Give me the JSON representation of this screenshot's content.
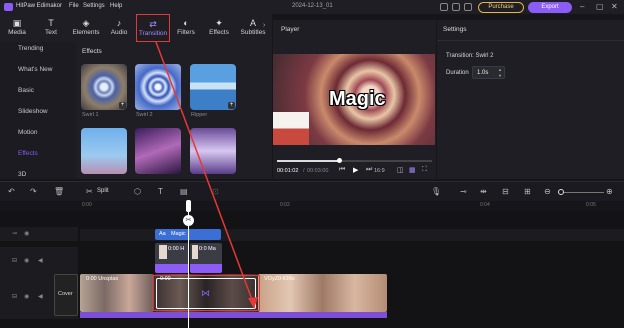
{
  "app": {
    "title": "HitPaw Edimakor",
    "menu": [
      "File",
      "Settings",
      "Help"
    ],
    "project_date": "2024-12-13_01",
    "purchase_label": "Purchase",
    "export_label": "Export"
  },
  "toolbar": {
    "tools": [
      {
        "label": "Media",
        "icon": "media-icon"
      },
      {
        "label": "Text",
        "icon": "text-icon"
      },
      {
        "label": "Elements",
        "icon": "elements-icon"
      },
      {
        "label": "Audio",
        "icon": "audio-icon"
      },
      {
        "label": "Transition",
        "icon": "transition-icon",
        "active": true
      },
      {
        "label": "Filters",
        "icon": "filters-icon"
      },
      {
        "label": "Effects",
        "icon": "effects-icon"
      },
      {
        "label": "Subtitles",
        "icon": "subtitles-icon"
      }
    ]
  },
  "leftnav": {
    "items": [
      "Trending",
      "What's New",
      "Basic",
      "Slideshow",
      "Motion",
      "Effects",
      "3D"
    ],
    "active": "Effects"
  },
  "effects_panel": {
    "heading": "Effects",
    "items": [
      "Swirl 1",
      "Swirl 2",
      "Ripper"
    ]
  },
  "player": {
    "heading": "Player",
    "caption": "Magic",
    "time_current": "00:01:02",
    "time_total": "00:03:00",
    "aspect": "16:9",
    "progress_fraction": 0.4
  },
  "settings": {
    "heading": "Settings",
    "transition_label": "Transition: Swirl 2",
    "duration_label": "Duration",
    "duration_value": "1.0s"
  },
  "timeline": {
    "split_label": "Split",
    "ruler": [
      "0:00",
      "0:02",
      "0:04",
      "0:05"
    ],
    "text_clip": "Magic",
    "text_clip_prefix": "Aa",
    "sub_clips": [
      "0:00 H",
      "0:0 Ma"
    ],
    "cover_label": "Cover",
    "main_clips": [
      "0:00 Unsplas",
      "0:00",
      "VOyZ0-lO0o"
    ],
    "transition_marker": "⋈"
  },
  "colors": {
    "accent": "#8b5cf6",
    "highlight_red": "#e53935",
    "purchase_gold": "#e0b64a"
  }
}
